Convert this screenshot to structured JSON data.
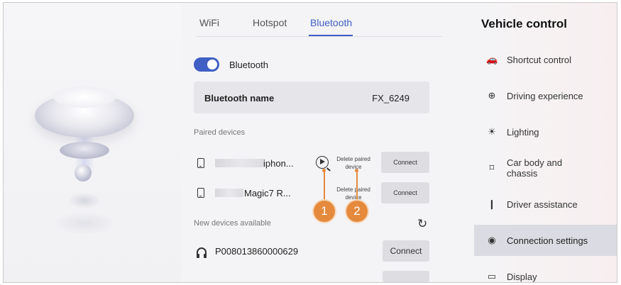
{
  "tabs": [
    {
      "label": "WiFi"
    },
    {
      "label": "Hotspot"
    },
    {
      "label": "Bluetooth"
    }
  ],
  "bluetooth": {
    "toggle_label": "Bluetooth",
    "toggle_on": true,
    "name_label": "Bluetooth name",
    "name_value": "FX_6249"
  },
  "paired": {
    "section_label": "Paired devices",
    "devices": [
      {
        "name": "iphon...",
        "delete_label": "Delete paired device",
        "connect_label": "Connect"
      },
      {
        "name": "Magic7 R...",
        "delete_label": "Delete paired device",
        "connect_label": "Connect"
      }
    ]
  },
  "new_devices": {
    "section_label": "New devices available",
    "devices": [
      {
        "name": "P008013860000629",
        "connect_label": "Connect"
      }
    ]
  },
  "callouts": [
    "1",
    "2"
  ],
  "vehicle_control": {
    "title": "Vehicle control",
    "items": [
      {
        "label": "Shortcut control",
        "icon": "car-icon"
      },
      {
        "label": "Driving experience",
        "icon": "steering-wheel-icon"
      },
      {
        "label": "Lighting",
        "icon": "light-icon"
      },
      {
        "label": "Car body and chassis",
        "icon": "chassis-icon"
      },
      {
        "label": "Driver assistance",
        "icon": "driver-assist-icon"
      },
      {
        "label": "Connection settings",
        "icon": "connection-icon",
        "active": true
      },
      {
        "label": "Display",
        "icon": "display-icon"
      }
    ]
  },
  "colors": {
    "accent": "#3f5fc4",
    "callout": "#e58a3d"
  }
}
